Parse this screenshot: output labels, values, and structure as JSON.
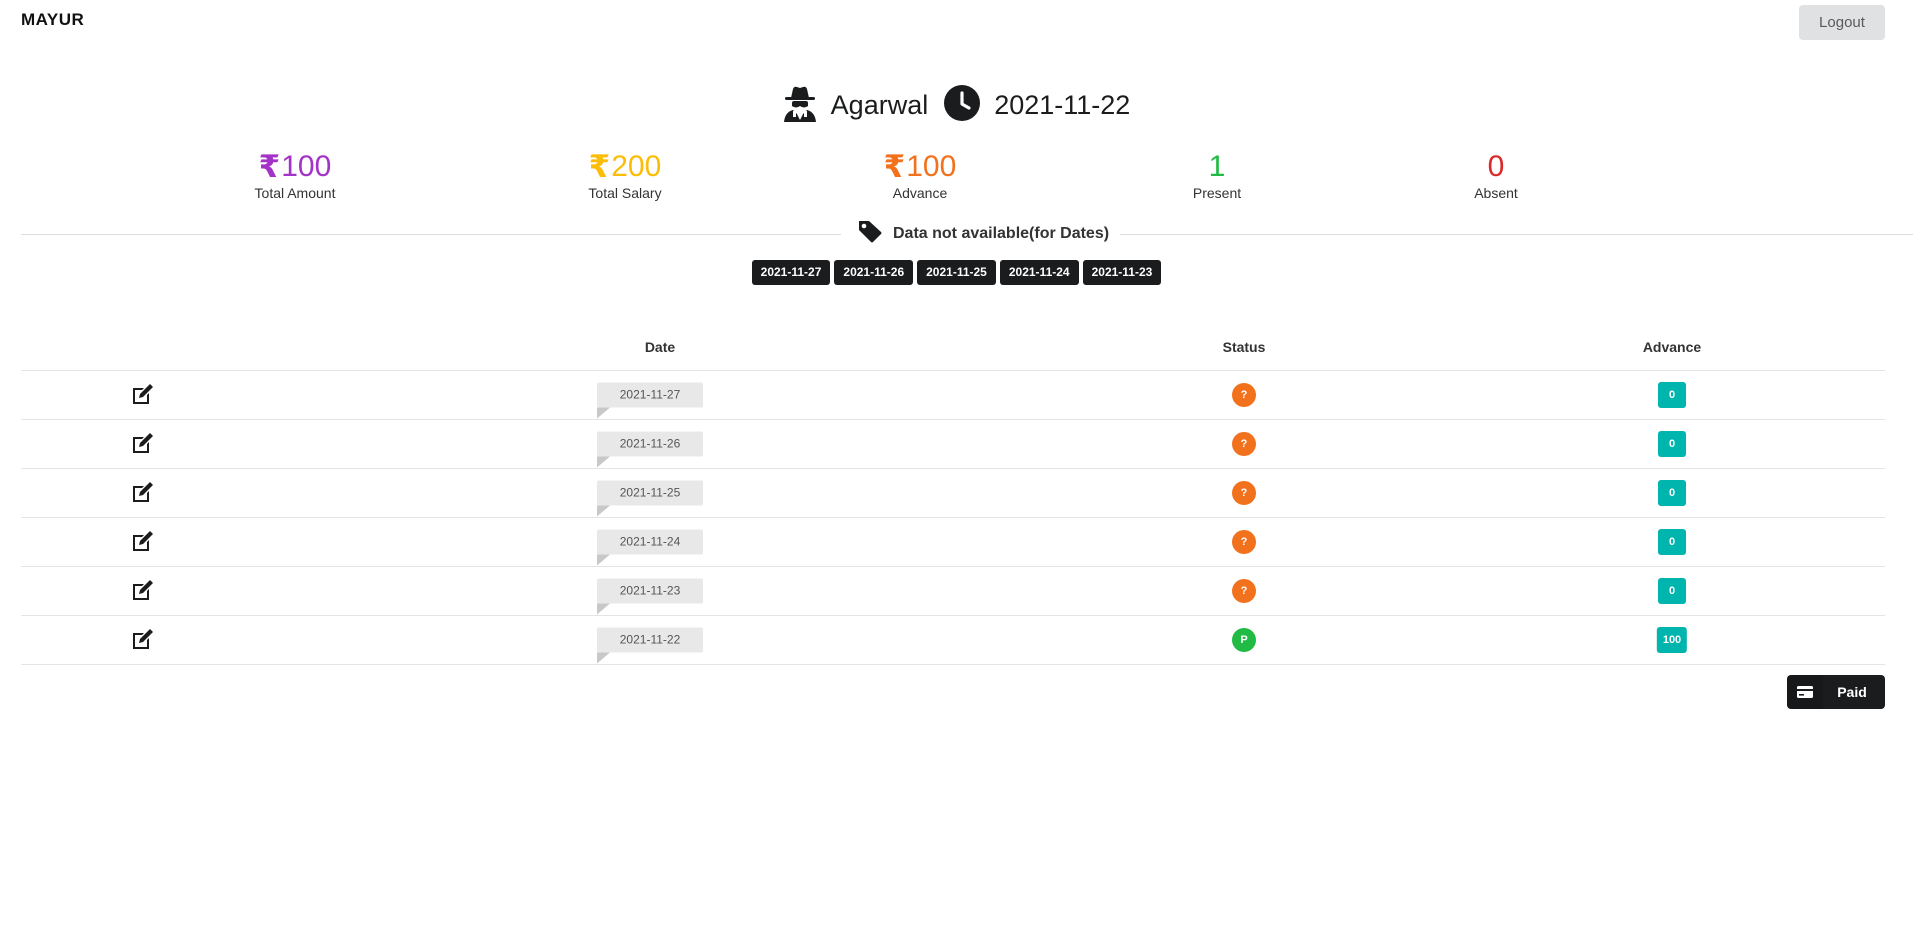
{
  "app": {
    "brand": "MAYUR",
    "logout_label": "Logout"
  },
  "header": {
    "name": "Agarwal",
    "date": "2021-11-22",
    "user_icon": "spy-icon",
    "clock_icon": "clock-icon"
  },
  "stats": [
    {
      "symbol": "₹",
      "value": "100",
      "label": "Total Amount",
      "color": "#a333c8"
    },
    {
      "symbol": "₹",
      "value": "200",
      "label": "Total Salary",
      "color": "#fbbd08"
    },
    {
      "symbol": "₹",
      "value": "100",
      "label": "Advance",
      "color": "#f2711c"
    },
    {
      "symbol": "",
      "value": "1",
      "label": "Present",
      "color": "#21ba45"
    },
    {
      "symbol": "",
      "value": "0",
      "label": "Absent",
      "color": "#db2828"
    }
  ],
  "unavailable": {
    "title": "Data not available(for Dates)",
    "icon": "tag-icon",
    "dates": [
      "2021-11-27",
      "2021-11-26",
      "2021-11-25",
      "2021-11-24",
      "2021-11-23"
    ]
  },
  "table": {
    "headers": {
      "date": "Date",
      "status": "Status",
      "advance": "Advance"
    },
    "rows": [
      {
        "date": "2021-11-27",
        "status": "?",
        "status_color": "#f2711c",
        "advance": "0"
      },
      {
        "date": "2021-11-26",
        "status": "?",
        "status_color": "#f2711c",
        "advance": "0"
      },
      {
        "date": "2021-11-25",
        "status": "?",
        "status_color": "#f2711c",
        "advance": "0"
      },
      {
        "date": "2021-11-24",
        "status": "?",
        "status_color": "#f2711c",
        "advance": "0"
      },
      {
        "date": "2021-11-23",
        "status": "?",
        "status_color": "#f2711c",
        "advance": "0"
      },
      {
        "date": "2021-11-22",
        "status": "P",
        "status_color": "#21ba45",
        "advance": "100"
      }
    ]
  },
  "footer": {
    "paid_label": "Paid",
    "paid_icon": "credit-card-icon"
  }
}
